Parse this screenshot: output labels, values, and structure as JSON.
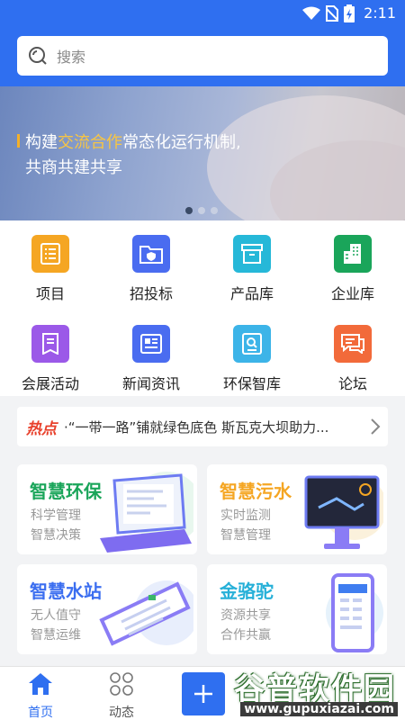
{
  "status": {
    "time": "2:11"
  },
  "search": {
    "placeholder": "搜索"
  },
  "banner": {
    "line1_a": "构建",
    "line1_hl": "交流合作",
    "line1_b": "常态化运行机制,",
    "line2": "共商共建共享"
  },
  "grid": [
    {
      "label": "项目",
      "icon": "list-icon",
      "color": "#f5a623"
    },
    {
      "label": "招投标",
      "icon": "folder-shield-icon",
      "color": "#4a6cf0"
    },
    {
      "label": "产品库",
      "icon": "box-icon",
      "color": "#26b8d8"
    },
    {
      "label": "企业库",
      "icon": "building-icon",
      "color": "#1aa55a"
    },
    {
      "label": "会展活动",
      "icon": "document-icon",
      "color": "#9b59e8"
    },
    {
      "label": "新闻资讯",
      "icon": "newspaper-icon",
      "color": "#4a6cf0"
    },
    {
      "label": "环保智库",
      "icon": "file-search-icon",
      "color": "#3cb4e8"
    },
    {
      "label": "论坛",
      "icon": "chat-icon",
      "color": "#f26a3a"
    }
  ],
  "news": {
    "tag": "热点",
    "text": "·“一带一路”铺就绿色底色 斯瓦克大坝助力..."
  },
  "cards": [
    {
      "title": "智慧环保",
      "sub1": "科学管理",
      "sub2": "智慧决策",
      "color": "#1aa55a"
    },
    {
      "title": "智慧污水",
      "sub1": "实时监测",
      "sub2": "智慧管理",
      "color": "#f5a623"
    },
    {
      "title": "智慧水站",
      "sub1": "无人值守",
      "sub2": "智慧运维",
      "color": "#3b6ef0"
    },
    {
      "title": "金骆驼",
      "sub1": "资源共享",
      "sub2": "合作共赢",
      "color": "#26b0d8"
    }
  ],
  "tabs": [
    {
      "label": "首页",
      "active_color": "#2f6ff0"
    },
    {
      "label": "动态"
    }
  ],
  "watermark": {
    "name": "谷普软件园",
    "url": "www.gupuxiazai.com"
  }
}
